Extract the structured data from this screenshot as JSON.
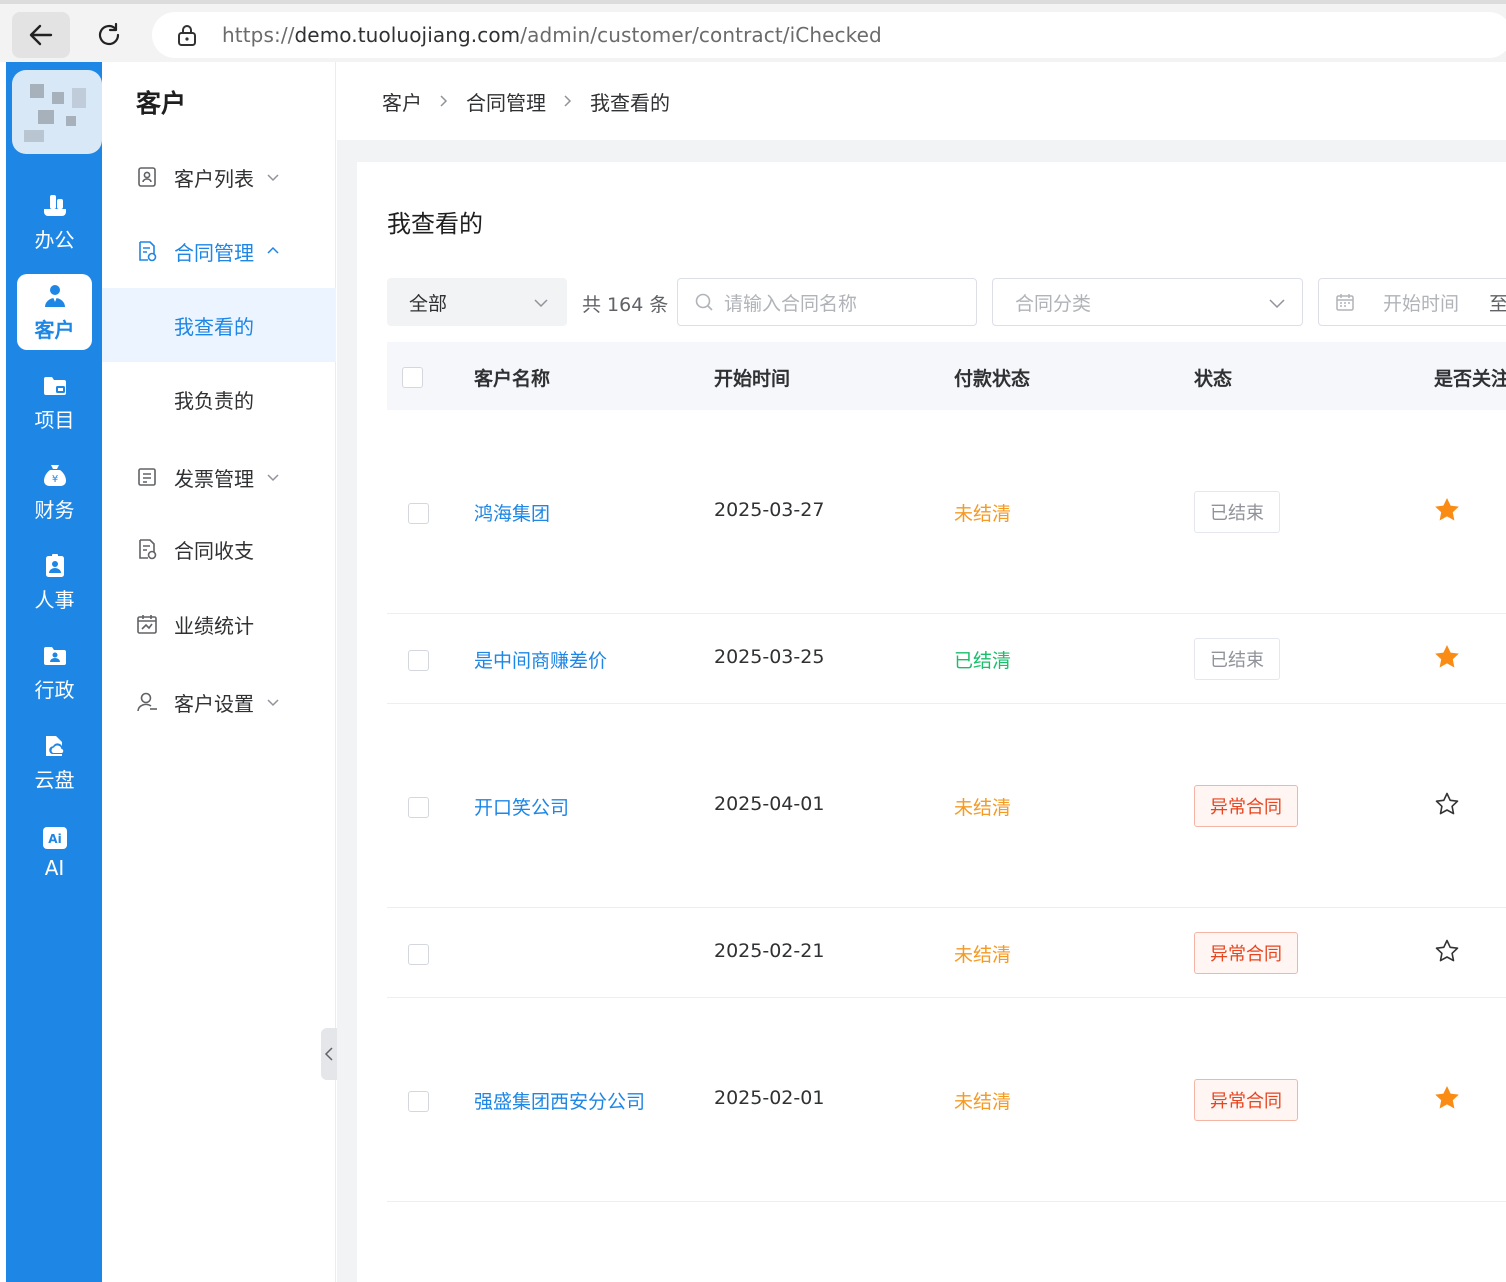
{
  "browser": {
    "url_scheme": "https://",
    "url_host": "demo.tuoluojiang.com",
    "url_path": "/admin/customer/contract/iChecked"
  },
  "rail": {
    "items": [
      {
        "label": "办公",
        "icon": "office-icon"
      },
      {
        "label": "客户",
        "icon": "customer-icon",
        "active": true
      },
      {
        "label": "项目",
        "icon": "project-folder-icon"
      },
      {
        "label": "财务",
        "icon": "finance-moneybag-icon"
      },
      {
        "label": "人事",
        "icon": "hr-badge-icon"
      },
      {
        "label": "行政",
        "icon": "admin-folder-icon"
      },
      {
        "label": "云盘",
        "icon": "cloud-drive-icon"
      },
      {
        "label": "AI",
        "icon": "ai-icon"
      }
    ]
  },
  "sidebar": {
    "title": "客户",
    "menu": [
      {
        "label": "客户列表",
        "icon": "customer-list-icon",
        "has_children": true,
        "expanded": false
      },
      {
        "label": "合同管理",
        "icon": "contract-icon",
        "has_children": true,
        "expanded": true,
        "children": [
          {
            "label": "我查看的",
            "active": true
          },
          {
            "label": "我负责的",
            "active": false
          }
        ]
      },
      {
        "label": "发票管理",
        "icon": "invoice-icon",
        "has_children": true,
        "expanded": false
      },
      {
        "label": "合同收支",
        "icon": "contract-payment-icon",
        "has_children": false
      },
      {
        "label": "业绩统计",
        "icon": "performance-calendar-icon",
        "has_children": false
      },
      {
        "label": "客户设置",
        "icon": "customer-settings-icon",
        "has_children": true,
        "expanded": false
      }
    ]
  },
  "breadcrumb": [
    "客户",
    "合同管理",
    "我查看的"
  ],
  "page": {
    "title": "我查看的",
    "filters": {
      "scope_value": "全部",
      "count_text": "共 164 条",
      "search_placeholder": "请输入合同名称",
      "category_placeholder": "合同分类",
      "start_placeholder": "开始时间",
      "range_sep": "至"
    }
  },
  "table": {
    "columns": [
      "客户名称",
      "开始时间",
      "付款状态",
      "状态",
      "是否关注"
    ],
    "rows": [
      {
        "name": "鸿海集团",
        "start": "2025-03-27",
        "pay": "未结清",
        "pay_kind": "unpaid",
        "status": "已结束",
        "status_kind": "ended",
        "followed": true
      },
      {
        "name": "是中间商赚差价",
        "start": "2025-03-25",
        "pay": "已结清",
        "pay_kind": "paid",
        "status": "已结束",
        "status_kind": "ended",
        "followed": true
      },
      {
        "name": "开口笑公司",
        "start": "2025-04-01",
        "pay": "未结清",
        "pay_kind": "unpaid",
        "status": "异常合同",
        "status_kind": "abnormal",
        "followed": false
      },
      {
        "name": "",
        "start": "2025-02-21",
        "pay": "未结清",
        "pay_kind": "unpaid",
        "status": "异常合同",
        "status_kind": "abnormal",
        "followed": false
      },
      {
        "name": "强盛集团西安分公司",
        "start": "2025-02-01",
        "pay": "未结清",
        "pay_kind": "unpaid",
        "status": "异常合同",
        "status_kind": "abnormal",
        "followed": true
      }
    ]
  },
  "colors": {
    "brand": "#1e86e5",
    "unpaid": "#f59a23",
    "paid": "#19be6b",
    "abnormal": "#e6451f",
    "star": "#fa8c16"
  }
}
